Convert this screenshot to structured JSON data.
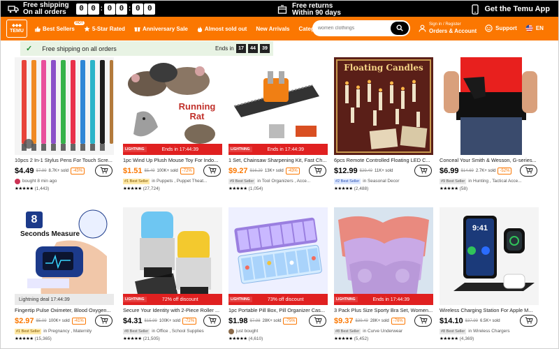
{
  "promo": {
    "free_shipping_line1": "Free shipping",
    "free_shipping_line2": "On all orders",
    "timer": [
      "0",
      "0",
      "0",
      "0",
      "0",
      "0"
    ],
    "free_returns_line1": "Free returns",
    "free_returns_line2": "Within 90 days",
    "app_label": "Get the Temu App"
  },
  "nav": {
    "logo_line1": "TEMU",
    "items": [
      {
        "label": "Best Sellers",
        "icon": "thumbs-up-icon"
      },
      {
        "label": "5-Star Rated",
        "icon": "star-icon"
      },
      {
        "label": "Anniversary Sale",
        "icon": "gift-icon"
      },
      {
        "label": "Almost sold out",
        "icon": "fire-icon"
      },
      {
        "label": "New Arrivals",
        "icon": ""
      },
      {
        "label": "Categories",
        "icon": ""
      }
    ],
    "hot_badge": "HOT",
    "search_placeholder": "women clothings",
    "account_line1": "Sign in / Register",
    "account_line2": "Orders & Account",
    "support_label": "Support",
    "language_label": "EN",
    "accent_color": "#fb7701"
  },
  "shipping_banner": {
    "text": "Free shipping on all orders",
    "ends_label": "Ends in",
    "hours": "17",
    "minutes": "44",
    "seconds": "39"
  },
  "products": [
    {
      "title": "10pcs 2 In-1 Stylus Pens For Touch Scre...",
      "price": "$4.49",
      "old": "$7.99",
      "sold": "8.7K+ sold",
      "disc": "-43%",
      "price_orange": false,
      "flash": "",
      "meta_badge": "",
      "meta_text": "bought 8 min ago",
      "meta_avatar": true,
      "stars": "★★★★★",
      "reviews": "(1,443)"
    },
    {
      "title": "1pc Wind Up Plush Mouse Toy For Indo...",
      "price": "$1.51",
      "old": "$5.49",
      "sold": "100K+ sold",
      "disc": "-72%",
      "price_orange": true,
      "flash": "Ends in 17:44:39",
      "flash_light": false,
      "meta_badge": "#1 Best Seller",
      "badge_style": "gold",
      "meta_text": "in Puppets , Puppet Theat...",
      "meta_avatar": false,
      "stars": "★★★★★",
      "reviews": "(27,724)",
      "overlay": "Running Rat"
    },
    {
      "title": "1 Set, Chainsaw Sharpening Kit, Fast Ch...",
      "price": "$9.27",
      "old": "$16.29",
      "sold": "13K+ sold",
      "disc": "-43%",
      "price_orange": true,
      "flash": "Ends in 17:44:39",
      "flash_light": false,
      "meta_badge": "#9 Best Seller",
      "badge_style": "gray",
      "meta_text": "in Tool Organizers , Acce...",
      "meta_avatar": false,
      "stars": "★★★★★",
      "reviews": "(1,054)"
    },
    {
      "title": "6pcs Remote Controlled Floating LED C...",
      "price": "$12.99",
      "old": "$29.49",
      "sold": "11K+ sold",
      "disc": "",
      "price_orange": false,
      "flash": "",
      "meta_badge": "#2 Best Seller",
      "badge_style": "blue",
      "meta_text": "in Seasonal Decor",
      "meta_avatar": false,
      "stars": "★★★★★",
      "reviews": "(2,488)",
      "overlay": "Floating Candles"
    },
    {
      "title": "Conceal Your Smith & Wesson, G-series...",
      "price": "$6.99",
      "old": "$14.69",
      "sold": "2.7K+ sold",
      "disc": "-52%",
      "price_orange": false,
      "flash": "",
      "meta_badge": "#9 Best Seller",
      "badge_style": "gray",
      "meta_text": "in Hunting , Tactical Acce...",
      "meta_avatar": false,
      "stars": "★★★★★",
      "reviews": "(58)"
    },
    {
      "title": "Fingertip Pulse Oximeter, Blood Oxygen...",
      "price": "$2.97",
      "old": "$5.09",
      "sold": "100K+ sold",
      "disc": "-41%",
      "price_orange": true,
      "flash": "Lightning deal   17:44:39",
      "flash_light": true,
      "meta_badge": "#1 Best Seller",
      "badge_style": "gold",
      "meta_text": "in Pregnancy , Maternity",
      "meta_avatar": false,
      "stars": "★★★★★",
      "reviews": "(15,365)",
      "overlay": "Seconds Measure",
      "overlay_num": "8"
    },
    {
      "title": "Secure Your Identity with 2-Piece Roller ...",
      "price": "$4.31",
      "old": "$15.99",
      "sold": "100K+ sold",
      "disc": "-72%",
      "price_orange": false,
      "flash": "72% off discount",
      "flash_light": false,
      "meta_badge": "#8 Best Seller",
      "badge_style": "gray",
      "meta_text": "in Office , School Supplies",
      "meta_avatar": false,
      "stars": "★★★★★",
      "reviews": "(21,505)"
    },
    {
      "title": "1pc Portable Pill Box, Pill Organizer Cas...",
      "price": "$1.98",
      "old": "$7.98",
      "sold": "28K+ sold",
      "disc": "-75%",
      "price_orange": false,
      "flash": "73% off discount",
      "flash_light": false,
      "meta_badge": "",
      "meta_text": "just bought",
      "meta_avatar": true,
      "stars": "★★★★★",
      "reviews": "(4,610)"
    },
    {
      "title": "3 Pack Plus Size Sporty Bra Set, Women...",
      "price": "$9.37",
      "old": "$39.49",
      "sold": "28K+ sold",
      "disc": "-76%",
      "price_orange": true,
      "flash": "Ends in 17:44:39",
      "flash_light": false,
      "meta_badge": "#8 Best Seller",
      "badge_style": "gray",
      "meta_text": "in Curve Underwear",
      "meta_avatar": false,
      "stars": "★★★★★",
      "reviews": "(5,452)"
    },
    {
      "title": "Wireless Charging Station For Apple M...",
      "price": "$14.10",
      "old": "$37.99",
      "sold": "6.5K+ sold",
      "disc": "",
      "price_orange": false,
      "flash": "",
      "meta_badge": "#8 Best Seller",
      "badge_style": "gray",
      "meta_text": "in Wireless Chargers",
      "meta_avatar": false,
      "stars": "★★★★★",
      "reviews": "(4,369)",
      "overlay": "9:41"
    }
  ]
}
